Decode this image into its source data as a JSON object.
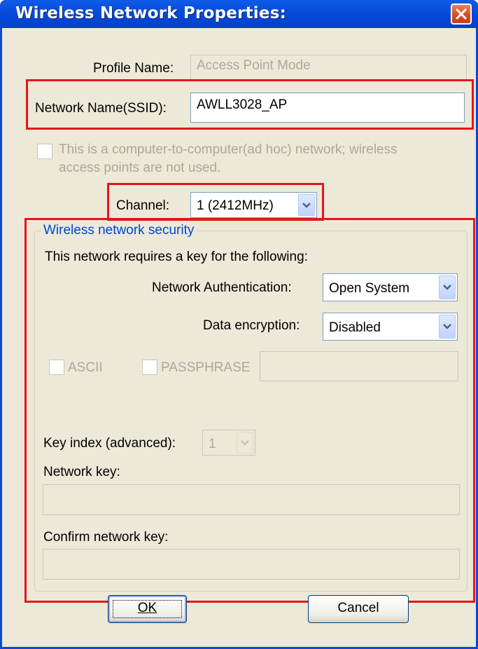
{
  "window": {
    "title": "Wireless Network Properties:"
  },
  "profile": {
    "label": "Profile Name:",
    "value": "Access Point Mode"
  },
  "ssid": {
    "label": "Network Name(SSID):",
    "value": "AWLL3028_AP"
  },
  "adhoc": {
    "line1": "This is a computer-to-computer(ad hoc) network; wireless",
    "line2": "access points are not used.",
    "checked": false
  },
  "channel": {
    "label": "Channel:",
    "value": "1  (2412MHz)"
  },
  "security": {
    "group_title": "Wireless network security",
    "requires_text": "This network requires a key for the following:",
    "auth_label": "Network Authentication:",
    "auth_value": "Open System",
    "enc_label": "Data encryption:",
    "enc_value": "Disabled",
    "ascii_label": "ASCII",
    "passphrase_label": "PASSPHRASE",
    "key_index_label": "Key index (advanced):",
    "key_index_value": "1",
    "network_key_label": "Network key:",
    "confirm_key_label": "Confirm network key:"
  },
  "buttons": {
    "ok_label": "OK",
    "cancel_label": "Cancel"
  },
  "colors": {
    "highlight": "#e8141b",
    "titlebar": "#0a4fdb",
    "group_title": "#0046d5",
    "dialog_bg": "#ece9d8"
  },
  "icons": {
    "close": "close-icon",
    "dropdown": "chevron-down-icon"
  }
}
